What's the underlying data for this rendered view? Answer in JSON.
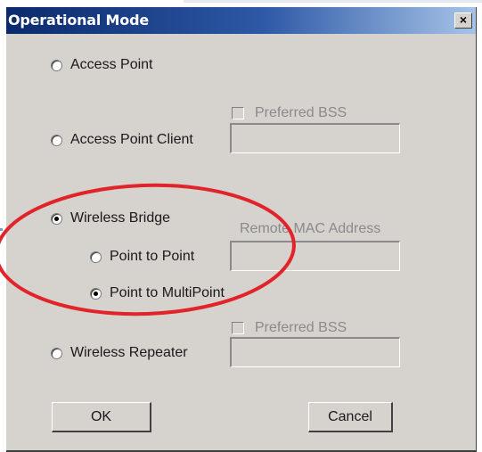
{
  "dialog": {
    "title": "Operational Mode",
    "close_glyph": "×",
    "close_icon": "close-icon"
  },
  "modes": {
    "access_point": {
      "label": "Access Point",
      "selected": false
    },
    "ap_client": {
      "label": "Access Point Client",
      "selected": false,
      "preferred_bss": "Preferred BSS",
      "preferred_bss_checked": false
    },
    "bridge": {
      "label": "Wireless Bridge",
      "selected": true,
      "remote_mac_label": "Remote MAC Address",
      "point_to_point": {
        "label": "Point to Point",
        "selected": false
      },
      "point_to_multipoint": {
        "label": "Point to MultiPoint",
        "selected": true
      }
    },
    "repeater": {
      "label": "Wireless Repeater",
      "selected": false,
      "preferred_bss": "Preferred BSS",
      "preferred_bss_checked": false
    }
  },
  "buttons": {
    "ok": "OK",
    "cancel": "Cancel"
  },
  "colors": {
    "annotation": "#e0242a",
    "title_gradient_start": "#0a2a6c",
    "dialog_face": "#d6d3ce"
  }
}
